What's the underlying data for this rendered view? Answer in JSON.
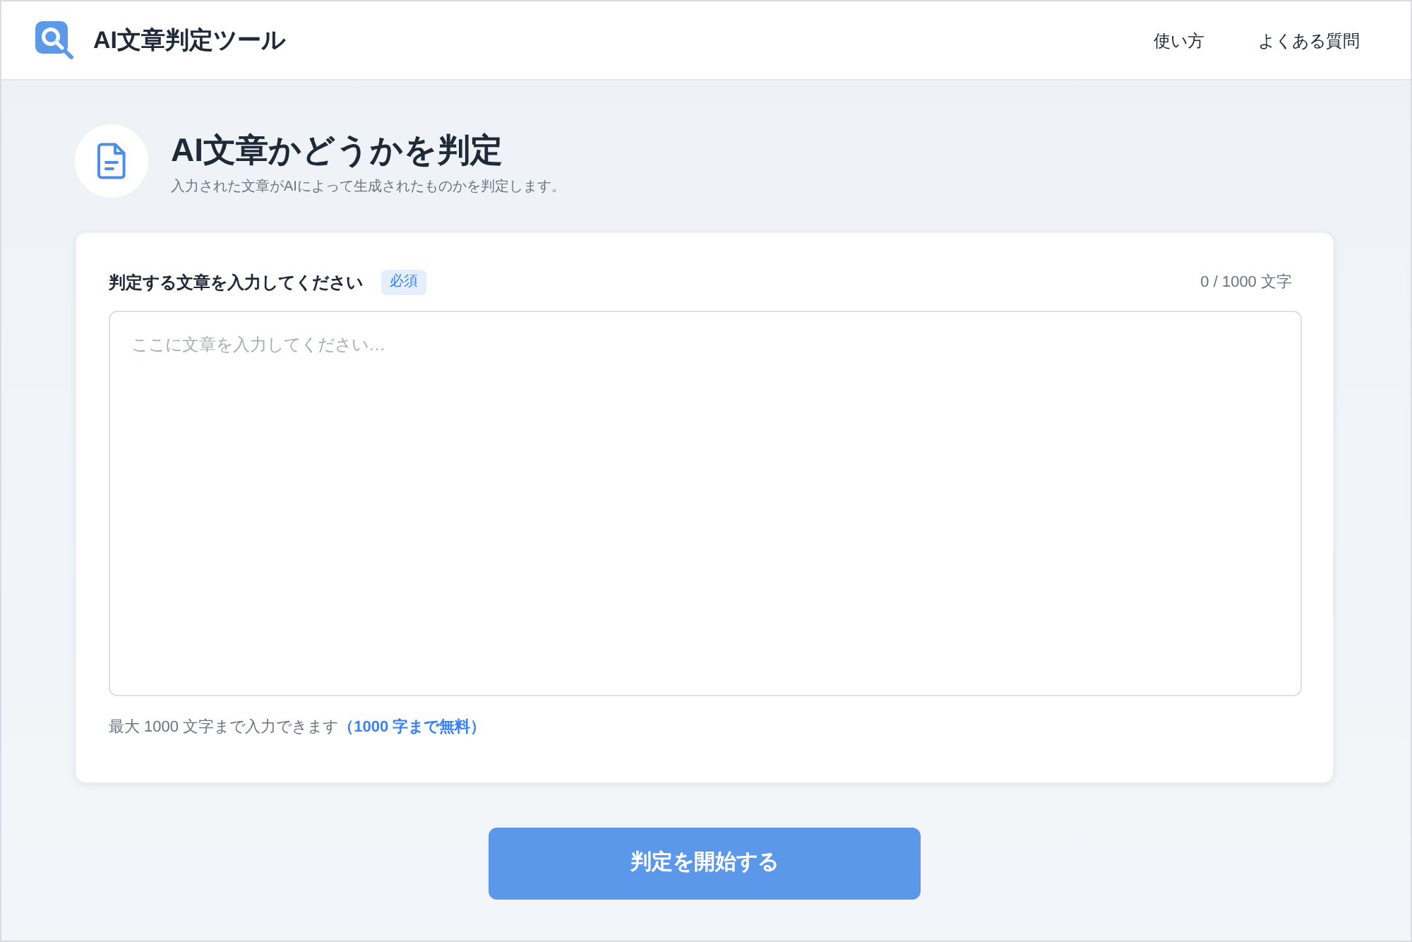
{
  "header": {
    "title": "AI文章判定ツール",
    "nav": [
      "使い方",
      "よくある質問"
    ]
  },
  "intro": {
    "title": "AI文章かどうかを判定",
    "subtitle": "入力された文章がAIによって生成されたものかを判定します。"
  },
  "form": {
    "label": "判定する文章を入力してください",
    "badge": "必須",
    "counter": "0 / 1000 文字",
    "textarea": {
      "placeholder": "ここに文章を入力してください…"
    },
    "helper": "最大 1000 文字まで入力できます",
    "note": "（1000 字まで無料）"
  },
  "submit_button": "判定を開始する"
}
